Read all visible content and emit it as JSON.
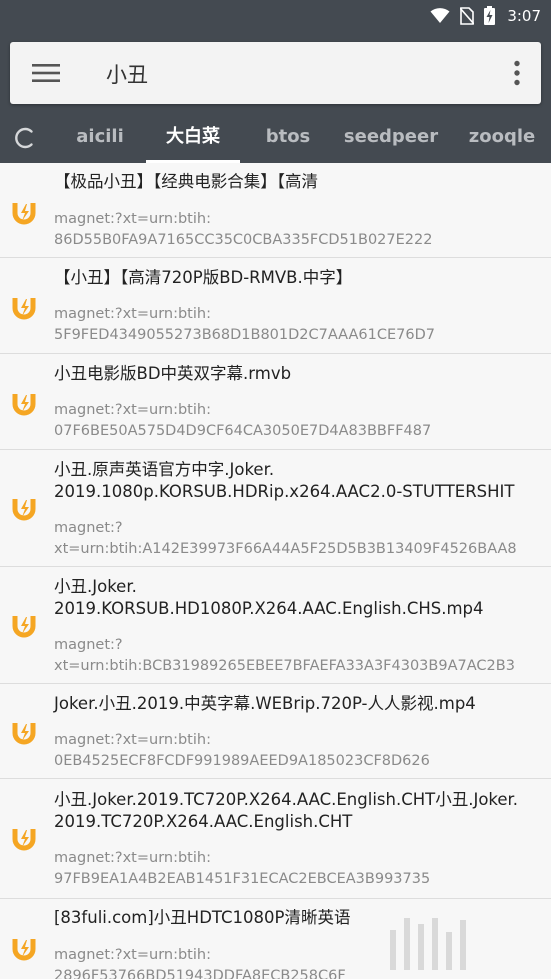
{
  "status_bar": {
    "time": "3:07",
    "icons": [
      "wifi-icon",
      "no-sim-icon",
      "battery-charging-icon"
    ]
  },
  "search": {
    "menu_icon": "hamburger-menu-icon",
    "query": "小丑",
    "more_icon": "more-vert-icon"
  },
  "tabs": {
    "loading_icon": "loading-spinner-icon",
    "items": [
      {
        "label": "aicili"
      },
      {
        "label": "大白菜"
      },
      {
        "label": "btos"
      },
      {
        "label": "seedpeer"
      },
      {
        "label": "zooqle"
      }
    ],
    "active_index": 1
  },
  "results": [
    {
      "icon": "magnet-icon",
      "title": "【极品小丑】【经典电影合集】【高清",
      "link": "magnet:?xt=urn:btih:\n86D55B0FA9A7165CC35C0CBA335FCD51B027E222"
    },
    {
      "icon": "magnet-icon",
      "title": "【小丑】【高清720P版BD-RMVB.中字】",
      "link": "magnet:?xt=urn:btih:\n5F9FED4349055273B68D1B801D2C7AAA61CE76D7"
    },
    {
      "icon": "magnet-icon",
      "title": "小丑电影版BD中英双字幕.rmvb",
      "link": "magnet:?xt=urn:btih:\n07F6BE50A575D4D9CF64CA3050E7D4A83BBFF487"
    },
    {
      "icon": "magnet-icon",
      "title": "小丑.原声英语官方中字.Joker.\n2019.1080p.KORSUB.HDRip.x264.AAC2.0-STUTTERSHIT",
      "link": "magnet:?\nxt=urn:btih:A142E39973F66A44A5F25D5B3B13409F4526BAA8"
    },
    {
      "icon": "magnet-icon",
      "title": "小丑.Joker.\n2019.KORSUB.HD1080P.X264.AAC.English.CHS.mp4",
      "link": "magnet:?\nxt=urn:btih:BCB31989265EBEE7BFAEFA33A3F4303B9A7AC2B3"
    },
    {
      "icon": "magnet-icon",
      "title": "Joker.小丑.2019.中英字幕.WEBrip.720P-人人影视.mp4",
      "link": "magnet:?xt=urn:btih:\n0EB4525ECF8FCDF991989AEED9A185023CF8D626"
    },
    {
      "icon": "magnet-icon",
      "title": "小丑.Joker.2019.TC720P.X264.AAC.English.CHT小丑.Joker.\n2019.TC720P.X264.AAC.English.CHT",
      "link": "magnet:?xt=urn:btih:\n97FB9EA1A4B2EAB1451F31ECAC2EBCEA3B993735"
    },
    {
      "icon": "magnet-icon",
      "title": "[83fuli.com]小丑HDTC1080P清晰英语",
      "link": "magnet:?xt=urn:btih:\n2896F53766BD51943DDFA8ECB258C6F"
    }
  ],
  "colors": {
    "toolbar": "#444a51",
    "magnet_orange": "#f5a623",
    "background": "#f7f7f7"
  }
}
